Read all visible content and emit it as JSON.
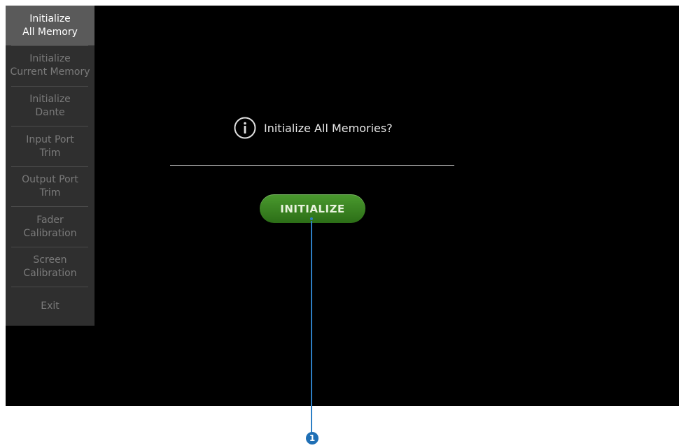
{
  "sidebar": {
    "items": [
      {
        "label": "Initialize\nAll Memory",
        "active": true
      },
      {
        "label": "Initialize\nCurrent Memory",
        "active": false
      },
      {
        "label": "Initialize\nDante",
        "active": false
      },
      {
        "label": "Input Port\nTrim",
        "active": false
      },
      {
        "label": "Output Port\nTrim",
        "active": false
      },
      {
        "label": "Fader\nCalibration",
        "active": false
      },
      {
        "label": "Screen\nCalibration",
        "active": false
      },
      {
        "label": "Exit",
        "active": false
      }
    ]
  },
  "dialog": {
    "icon": "info-icon",
    "message": "Initialize All Memories?",
    "button_label": "INITIALIZE"
  },
  "callout": {
    "number": "1"
  },
  "colors": {
    "screen_bg": "#000000",
    "sidebar_bg": "#2f2f2f",
    "active_item_bg": "#5a5a5a",
    "button_green": "#3a8a24",
    "callout_blue": "#2e7fc4"
  }
}
